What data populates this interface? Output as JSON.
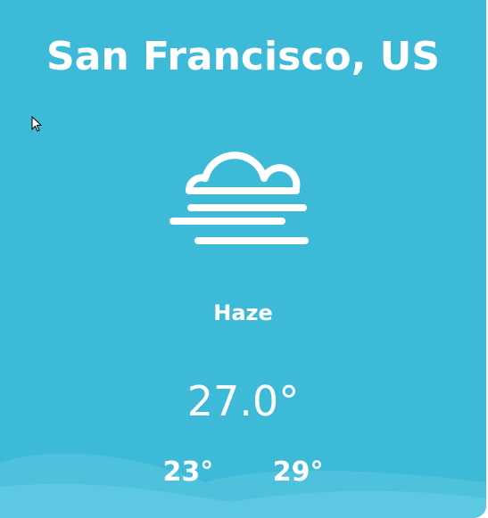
{
  "location": {
    "city": "San Francisco, US"
  },
  "weather": {
    "condition": "Haze",
    "icon": "haze-icon",
    "temperature": "27.0°",
    "min_temp": "23°",
    "max_temp": "29°"
  },
  "colors": {
    "background": "#3dbad8",
    "text": "#ffffff",
    "wave": "#5dc8e2"
  }
}
